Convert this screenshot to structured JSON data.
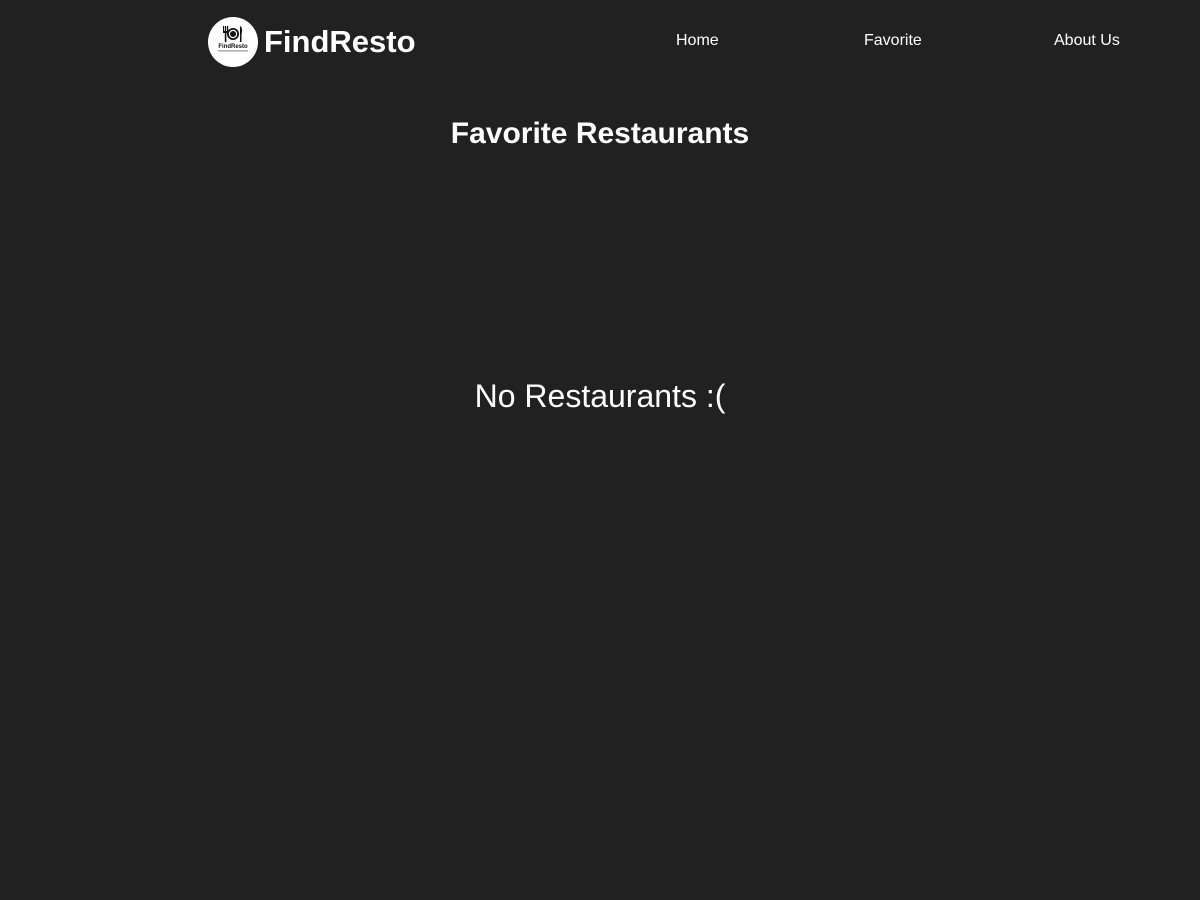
{
  "brand": {
    "name": "FindResto",
    "logo_text": "FindResto",
    "logo_tagline": "Find your favorite restaurant",
    "logo_icon": "fork-plate-knife-icon"
  },
  "nav": {
    "items": [
      {
        "label": "Home"
      },
      {
        "label": "Favorite"
      },
      {
        "label": "About Us"
      }
    ]
  },
  "main": {
    "title": "Favorite Restaurants",
    "empty_message": "No Restaurants :("
  },
  "colors": {
    "background": "#212121",
    "text": "#ffffff",
    "logo_background": "#ffffff"
  }
}
